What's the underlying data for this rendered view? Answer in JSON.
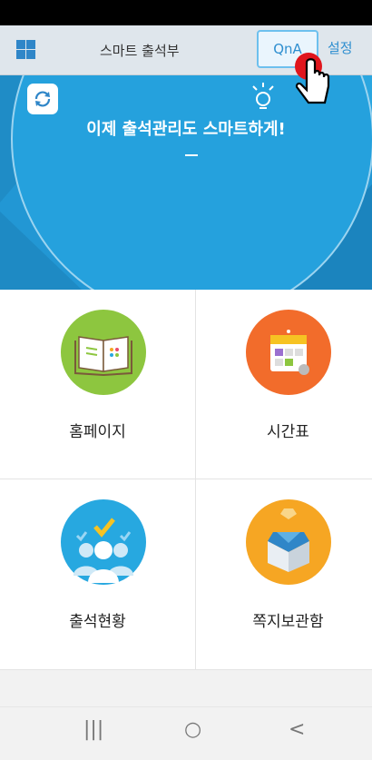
{
  "header": {
    "title": "스마트 출석부",
    "qna_label": "QnA",
    "settings_label": "설정"
  },
  "hero": {
    "slogan": "이제 출석관리도 스마트하게!"
  },
  "menu": [
    {
      "label": "홈페이지",
      "icon": "book-icon",
      "color": "#8dc63f"
    },
    {
      "label": "시간표",
      "icon": "calendar-icon",
      "color": "#f26c2b"
    },
    {
      "label": "출석현황",
      "icon": "people-check-icon",
      "color": "#27a8e0"
    },
    {
      "label": "쪽지보관함",
      "icon": "envelope-box-icon",
      "color": "#f6a623"
    }
  ],
  "navbar": {
    "recent": "|||",
    "home": "○",
    "back": "<"
  }
}
